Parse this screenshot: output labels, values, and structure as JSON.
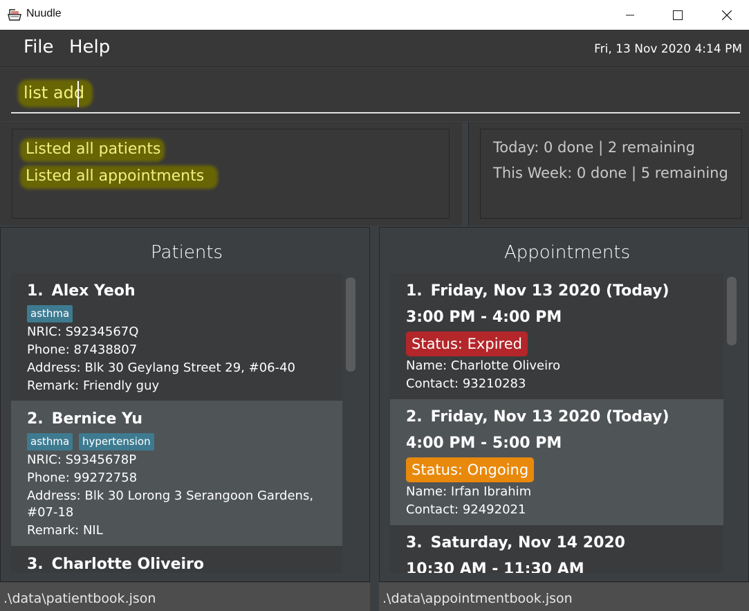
{
  "window": {
    "title": "Nuudle"
  },
  "menu": {
    "file": "File",
    "help": "Help",
    "datetime": "Fri, 13 Nov 2020 4:14 PM"
  },
  "command": {
    "value": "list add"
  },
  "result": {
    "lines": [
      "Listed all patients",
      "Listed all appointments"
    ]
  },
  "stats": {
    "today": "Today: 0 done | 2 remaining",
    "week": "This Week: 0 done | 5 remaining"
  },
  "patients": {
    "title": "Patients",
    "items": [
      {
        "index": "1.",
        "name": "Alex Yeoh",
        "tags": [
          "asthma"
        ],
        "nric": "NRIC: S9234567Q",
        "phone": "Phone: 87438807",
        "address": "Address: Blk 30 Geylang Street 29, #06-40",
        "remark": "Remark: Friendly guy"
      },
      {
        "index": "2.",
        "name": "Bernice Yu",
        "tags": [
          "asthma",
          "hypertension"
        ],
        "nric": "NRIC: S9345678P",
        "phone": "Phone: 99272758",
        "address": "Address: Blk 30 Lorong 3 Serangoon Gardens,",
        "address2": "#07-18",
        "remark": "Remark: NIL"
      },
      {
        "index": "3.",
        "name": "Charlotte Oliveiro"
      }
    ]
  },
  "appointments": {
    "title": "Appointments",
    "items": [
      {
        "index": "1.",
        "date": "Friday, Nov 13 2020 (Today)",
        "time": "3:00 PM - 4:00 PM",
        "status": "Status: Expired",
        "name": "Name: Charlotte Oliveiro",
        "contact": "Contact: 93210283"
      },
      {
        "index": "2.",
        "date": "Friday, Nov 13 2020 (Today)",
        "time": "4:00 PM - 5:00 PM",
        "status": "Status: Ongoing",
        "name": "Name: Irfan Ibrahim",
        "contact": "Contact: 92492021"
      },
      {
        "index": "3.",
        "date": "Saturday, Nov 14 2020",
        "time": "10:30 AM - 11:30 AM"
      }
    ]
  },
  "footer": {
    "patients_file": ".\\data\\patientbook.json",
    "appointments_file": ".\\data\\appointmentbook.json"
  },
  "colors": {
    "expired": "#b3262a",
    "ongoing": "#e8890c",
    "tag": "#3e7b91",
    "highlight": "#6e6a00"
  }
}
